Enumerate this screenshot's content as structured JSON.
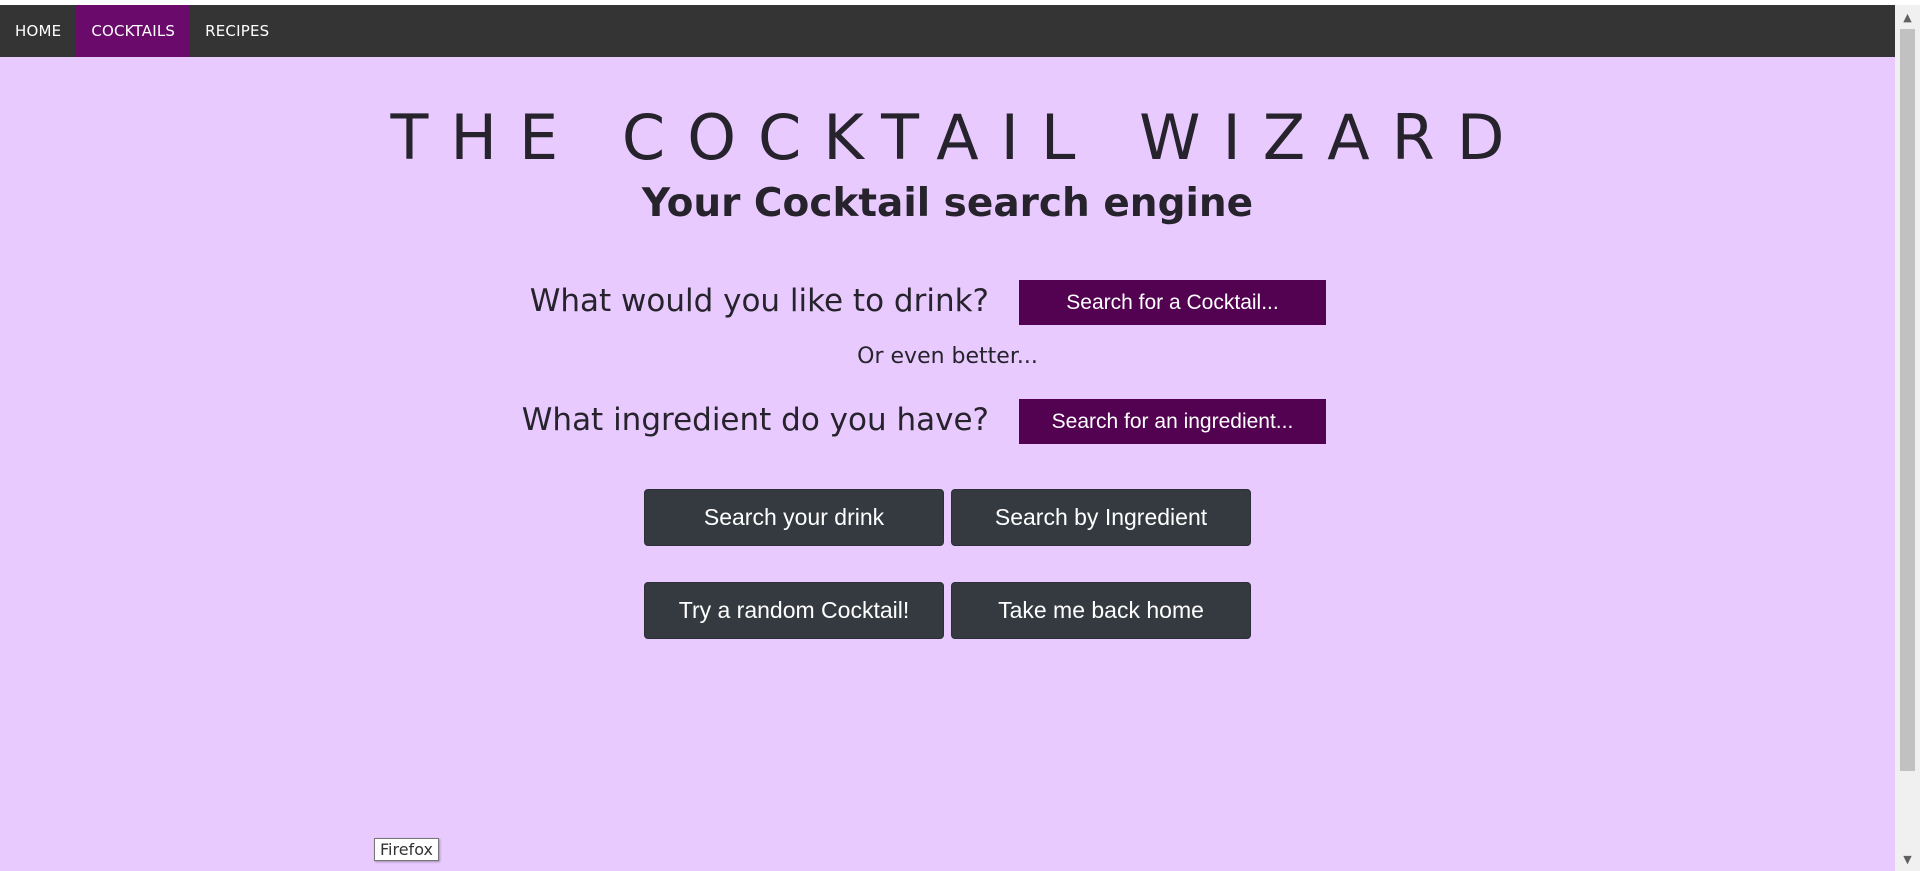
{
  "nav": {
    "items": [
      {
        "label": "HOME",
        "active": false
      },
      {
        "label": "COCKTAILS",
        "active": true
      },
      {
        "label": "RECIPES",
        "active": false
      }
    ]
  },
  "header": {
    "title": "THE COCKTAIL WIZARD",
    "subtitle": "Your Cocktail search engine"
  },
  "search": {
    "drink_question": "What would you like to drink?",
    "drink_button": "Search for a Cocktail...",
    "or_text": "Or even better...",
    "ingredient_question": "What ingredient do you have?",
    "ingredient_button": "Search for an ingredient..."
  },
  "actions": {
    "search_drink": "Search your drink",
    "search_ingredient": "Search by Ingredient",
    "random_cocktail": "Try a random Cocktail!",
    "back_home": "Take me back home"
  },
  "tooltip": {
    "text": "Firefox"
  },
  "colors": {
    "background": "#e8caff",
    "navbar": "#343434",
    "nav_active": "#6a0a6a",
    "purple_button": "#520250",
    "dark_button": "#343a40",
    "text": "#26232c"
  }
}
